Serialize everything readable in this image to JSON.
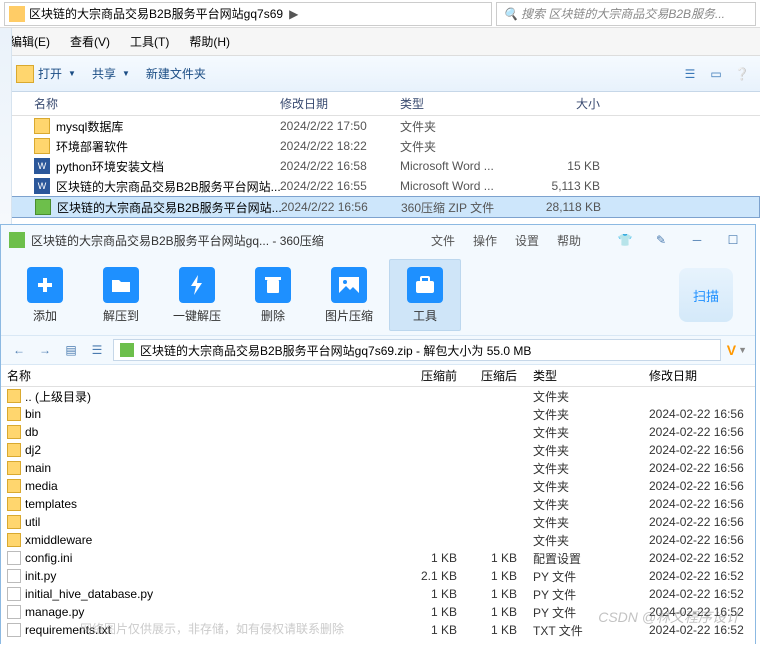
{
  "explorer": {
    "breadcrumb_text": "区块链的大宗商品交易B2B服务平台网站gq7s69",
    "search_placeholder": "搜索 区块链的大宗商品交易B2B服务...",
    "menu": {
      "edit": "编辑(E)",
      "view": "查看(V)",
      "tools": "工具(T)",
      "help": "帮助(H)"
    },
    "toolbar": {
      "open": "打开",
      "share": "共享",
      "newfolder": "新建文件夹"
    },
    "cols": {
      "name": "名称",
      "date": "修改日期",
      "type": "类型",
      "size": "大小"
    },
    "rows": [
      {
        "icon": "folder",
        "name": "mysql数据库",
        "date": "2024/2/22 17:50",
        "type": "文件夹",
        "size": ""
      },
      {
        "icon": "folder",
        "name": "环境部署软件",
        "date": "2024/2/22 18:22",
        "type": "文件夹",
        "size": ""
      },
      {
        "icon": "word",
        "name": "python环境安装文档",
        "date": "2024/2/22 16:58",
        "type": "Microsoft Word ...",
        "size": "15 KB"
      },
      {
        "icon": "word",
        "name": "区块链的大宗商品交易B2B服务平台网站...",
        "date": "2024/2/22 16:55",
        "type": "Microsoft Word ...",
        "size": "5,113 KB"
      },
      {
        "icon": "zip",
        "name": "区块链的大宗商品交易B2B服务平台网站...",
        "date": "2024/2/22 16:56",
        "type": "360压缩 ZIP 文件",
        "size": "28,118 KB"
      }
    ]
  },
  "zip": {
    "title": "区块链的大宗商品交易B2B服务平台网站gq... - 360压缩",
    "menu": {
      "file": "文件",
      "operate": "操作",
      "settings": "设置",
      "help": "帮助"
    },
    "tools": {
      "add": "添加",
      "extract": "解压到",
      "oneclick": "一键解压",
      "delete": "删除",
      "piccomp": "图片压缩",
      "tool": "工具",
      "scan": "扫描"
    },
    "path": "区块链的大宗商品交易B2B服务平台网站gq7s69.zip - 解包大小为 55.0 MB",
    "vbadge": "V",
    "cols": {
      "name": "名称",
      "before": "压缩前",
      "after": "压缩后",
      "type": "类型",
      "date": "修改日期"
    },
    "rows": [
      {
        "icon": "fold",
        "name": ".. (上级目录)",
        "before": "",
        "after": "",
        "type": "文件夹",
        "date": ""
      },
      {
        "icon": "fold",
        "name": "bin",
        "before": "",
        "after": "",
        "type": "文件夹",
        "date": "2024-02-22 16:56"
      },
      {
        "icon": "fold",
        "name": "db",
        "before": "",
        "after": "",
        "type": "文件夹",
        "date": "2024-02-22 16:56"
      },
      {
        "icon": "fold",
        "name": "dj2",
        "before": "",
        "after": "",
        "type": "文件夹",
        "date": "2024-02-22 16:56"
      },
      {
        "icon": "fold",
        "name": "main",
        "before": "",
        "after": "",
        "type": "文件夹",
        "date": "2024-02-22 16:56"
      },
      {
        "icon": "fold",
        "name": "media",
        "before": "",
        "after": "",
        "type": "文件夹",
        "date": "2024-02-22 16:56"
      },
      {
        "icon": "fold",
        "name": "templates",
        "before": "",
        "after": "",
        "type": "文件夹",
        "date": "2024-02-22 16:56"
      },
      {
        "icon": "fold",
        "name": "util",
        "before": "",
        "after": "",
        "type": "文件夹",
        "date": "2024-02-22 16:56"
      },
      {
        "icon": "fold",
        "name": "xmiddleware",
        "before": "",
        "after": "",
        "type": "文件夹",
        "date": "2024-02-22 16:56"
      },
      {
        "icon": "ini",
        "name": "config.ini",
        "before": "1 KB",
        "after": "1 KB",
        "type": "配置设置",
        "date": "2024-02-22 16:52"
      },
      {
        "icon": "py",
        "name": "init.py",
        "before": "2.1 KB",
        "after": "1 KB",
        "type": "PY 文件",
        "date": "2024-02-22 16:52"
      },
      {
        "icon": "py",
        "name": "initial_hive_database.py",
        "before": "1 KB",
        "after": "1 KB",
        "type": "PY 文件",
        "date": "2024-02-22 16:52"
      },
      {
        "icon": "py",
        "name": "manage.py",
        "before": "1 KB",
        "after": "1 KB",
        "type": "PY 文件",
        "date": "2024-02-22 16:52"
      },
      {
        "icon": "txt",
        "name": "requirements.txt",
        "before": "1 KB",
        "after": "1 KB",
        "type": "TXT 文件",
        "date": "2024-02-22 16:52"
      }
    ]
  },
  "watermark1": "CSDN @林义程序设计",
  "watermark2": "网络图片仅供展示，非存储，如有侵权请联系删除"
}
